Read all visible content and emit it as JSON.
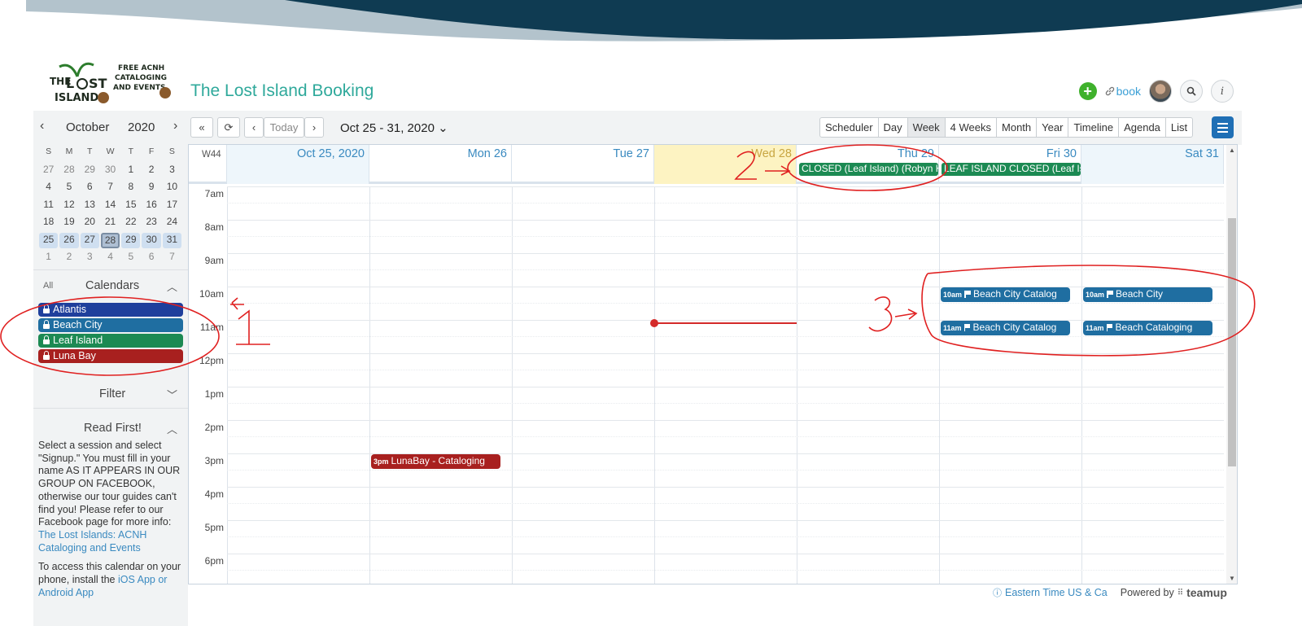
{
  "header": {
    "title": "The Lost Island Booking",
    "logo_text": "THE LOST ISLANDS · FREE ACNH CATALOGING AND EVENTS",
    "book_link": "book",
    "icons": [
      "add-icon",
      "link-icon",
      "avatar",
      "search-icon",
      "info-icon"
    ]
  },
  "mini_calendar": {
    "month": "October",
    "year": "2020",
    "dow": [
      "S",
      "M",
      "T",
      "W",
      "T",
      "F",
      "S"
    ],
    "weeks": [
      [
        "27",
        "28",
        "29",
        "30",
        "1",
        "2",
        "3"
      ],
      [
        "4",
        "5",
        "6",
        "7",
        "8",
        "9",
        "10"
      ],
      [
        "11",
        "12",
        "13",
        "14",
        "15",
        "16",
        "17"
      ],
      [
        "18",
        "19",
        "20",
        "21",
        "22",
        "23",
        "24"
      ],
      [
        "25",
        "26",
        "27",
        "28",
        "29",
        "30",
        "31"
      ],
      [
        "1",
        "2",
        "3",
        "4",
        "5",
        "6",
        "7"
      ]
    ],
    "today": "28"
  },
  "sidebar": {
    "all_label": "All",
    "calendars_title": "Calendars",
    "calendars": [
      {
        "name": "Atlantis",
        "color": "#1f3f9c"
      },
      {
        "name": "Beach City",
        "color": "#1f6ea1"
      },
      {
        "name": "Leaf Island",
        "color": "#1c8a53"
      },
      {
        "name": "Luna Bay",
        "color": "#a8201f"
      }
    ],
    "filter_title": "Filter",
    "read_first_title": "Read First!",
    "read_first_p1": "Select a session and select \"Signup.\" You must fill in your name AS IT APPEARS IN OUR GROUP ON FACEBOOK, otherwise our tour guides can't find you!  Please refer to our Facebook page for more info: ",
    "read_first_link": "The Lost Islands: ACNH Cataloging and Events",
    "read_first_p2": "To access this calendar on your phone, install the ",
    "read_first_p2_link": "iOS App or Android App"
  },
  "toolbar": {
    "today": "Today",
    "date_range": "Oct 25 - 31, 2020",
    "views": [
      "Scheduler",
      "Day",
      "Week",
      "4 Weeks",
      "Month",
      "Year",
      "Timeline",
      "Agenda",
      "List"
    ],
    "active_view": "Week"
  },
  "week": {
    "label": "W44",
    "days": [
      "Oct 25, 2020",
      "Mon 26",
      "Tue 27",
      "Wed 28",
      "Thu 29",
      "Fri 30",
      "Sat 31"
    ],
    "hours": [
      "7am",
      "8am",
      "9am",
      "10am",
      "11am",
      "12pm",
      "1pm",
      "2pm",
      "3pm",
      "4pm",
      "5pm",
      "6pm"
    ]
  },
  "all_day_events": [
    {
      "text": "CLOSED (Leaf Island) (Robyn K",
      "day": 4,
      "color": "#1c8a53"
    },
    {
      "text": "LEAF ISLAND CLOSED (Leaf Is",
      "day": 5,
      "color": "#1c8a53"
    }
  ],
  "events": [
    {
      "time": "3pm",
      "title": "LunaBay - Cataloging",
      "day": 1,
      "color": "#a8201f"
    },
    {
      "time": "10am",
      "title": "Beach City Catalog",
      "day": 5,
      "color": "#1f6ea1"
    },
    {
      "time": "10am",
      "title": "Beach City",
      "day": 6,
      "color": "#1f6ea1"
    },
    {
      "time": "11am",
      "title": "Beach City Catalog",
      "day": 5,
      "color": "#1f6ea1"
    },
    {
      "time": "11am",
      "title": "Beach Cataloging",
      "day": 6,
      "color": "#1f6ea1"
    }
  ],
  "footer": {
    "timezone": "Eastern Time US & Ca",
    "powered_by": "Powered by",
    "brand": "teamup"
  }
}
